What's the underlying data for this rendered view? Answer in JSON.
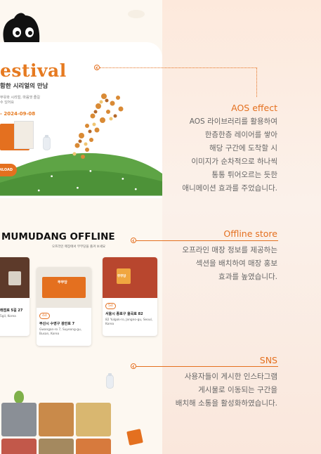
{
  "hero": {
    "title": "estival",
    "subtitle": "함한 시리얼의 만남",
    "desc": "무유와 시리얼, 마음껏 즐길 수 있어요",
    "date": "- 2024-09-08",
    "download_label": "NLOAD"
  },
  "offline": {
    "title": "MUMUDANG OFFLINE",
    "subtitle": "오프라인 매장에서 무무당을 즐겨 보세요",
    "stores": [
      {
        "badge": "",
        "name": "래점로 5길 27",
        "addr": "5gil, Korea",
        "sign": ""
      },
      {
        "badge": "4st",
        "name": "부산시 수영구 광안로 7",
        "addr": "Gwangan-ro 7, Suyeong-gu, Busan, Korea",
        "sign": "무무당"
      },
      {
        "badge": "5st",
        "name": "서울시 종로구 율곡로 82",
        "addr": "82 Yulgok-ro, Jongno-gu, Seoul, Korea",
        "sign": "무무당"
      }
    ]
  },
  "annotations": [
    {
      "title": "AOS effect",
      "lines": [
        "AOS 라이브러리를 활용하여",
        "한층한층 레이어를 쌓아",
        "해당 구간에 도착할 시",
        "이미지가 순차적으로 하나씩",
        "통통 튀어오르는 듯한",
        "애니메이션 효과를 주었습니다."
      ]
    },
    {
      "title": "Offline store",
      "lines": [
        "오프라인 매장 정보를 제공하는",
        "섹션을 배치하여 매장 홍보",
        "효과를 높였습니다."
      ]
    },
    {
      "title": "SNS",
      "lines": [
        "사용자들이 게시한 인스타그램",
        "게시물로 이동되는 구간을",
        "배치해 소통을 활성화하였습니다."
      ]
    }
  ],
  "colors": {
    "accent": "#e4701f",
    "panel": "#fbeee6",
    "hill": "#5ea445"
  }
}
